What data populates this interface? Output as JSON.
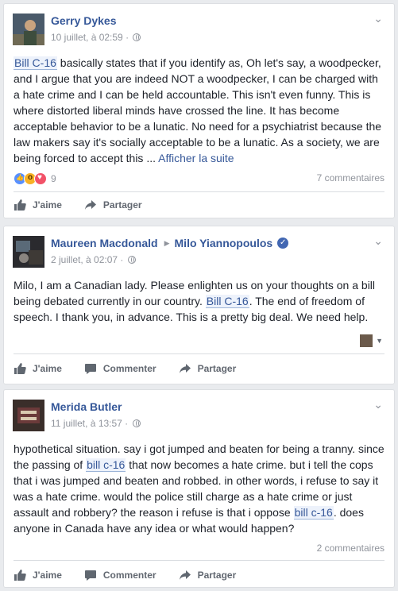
{
  "posts": [
    {
      "author": "Gerry Dykes",
      "time": "10 juillet, à 02:59 ·",
      "text_pre": "",
      "tag1": "Bill C-16",
      "text_mid": " basically states that if you identify as, Oh let's say, a woodpecker, and I argue that you are indeed NOT a woodpecker, I can be charged with a hate crime and I can be held accountable. This isn't even funny. This is where distorted liberal minds have crossed the line. It has become acceptable behavior to be a lunatic. No need for a psychiatrist because the law makers say it's socially acceptable to be a lunatic. As a society, we are being forced to accept this ... ",
      "more": "Afficher la suite",
      "reaction_count": "9",
      "comments": "7 commentaires",
      "actions": [
        "J'aime",
        "Partager"
      ]
    },
    {
      "author": "Maureen Macdonald",
      "target": "Milo Yiannopoulos",
      "time": "2 juillet, à 02:07 ·",
      "text_pre": "Milo, I am a Canadian lady. Please enlighten us on your thoughts on a bill being debated currently in our country. ",
      "tag1": "Bill C-16",
      "text_mid": ". The end of freedom of speech. I thank you, in advance. This is a pretty big deal. We need help.",
      "actions": [
        "J'aime",
        "Commenter",
        "Partager"
      ]
    },
    {
      "author": "Merida Butler",
      "time": "11 juillet, à 13:57 ·",
      "text_pre": "hypothetical situation. say i got jumped and beaten for being a tranny. since the passing of ",
      "tag1": "bill c-16",
      "text_mid": " that now becomes a hate crime. but i tell the cops that i was jumped and beaten and robbed. in other words, i refuse to say it was a hate crime. would the police still charge as a hate crime or just assault and robbery? the reason i refuse is that i oppose ",
      "tag2": "bill c-16",
      "text_post": ". does anyone in Canada have any idea or what would happen?",
      "comments": "2 commentaires",
      "actions": [
        "J'aime",
        "Commenter",
        "Partager"
      ]
    }
  ],
  "icons": {
    "like": "thumbs-up-icon",
    "comment": "comment-bubble-icon",
    "share": "share-arrow-icon",
    "privacy": "globe-icon",
    "menu": "chevron-down-icon"
  },
  "colors": {
    "link": "#365899",
    "meta": "#90949c",
    "background": "#e9ebee",
    "highlight": "#edf2fb",
    "verified": "#4267b2"
  }
}
